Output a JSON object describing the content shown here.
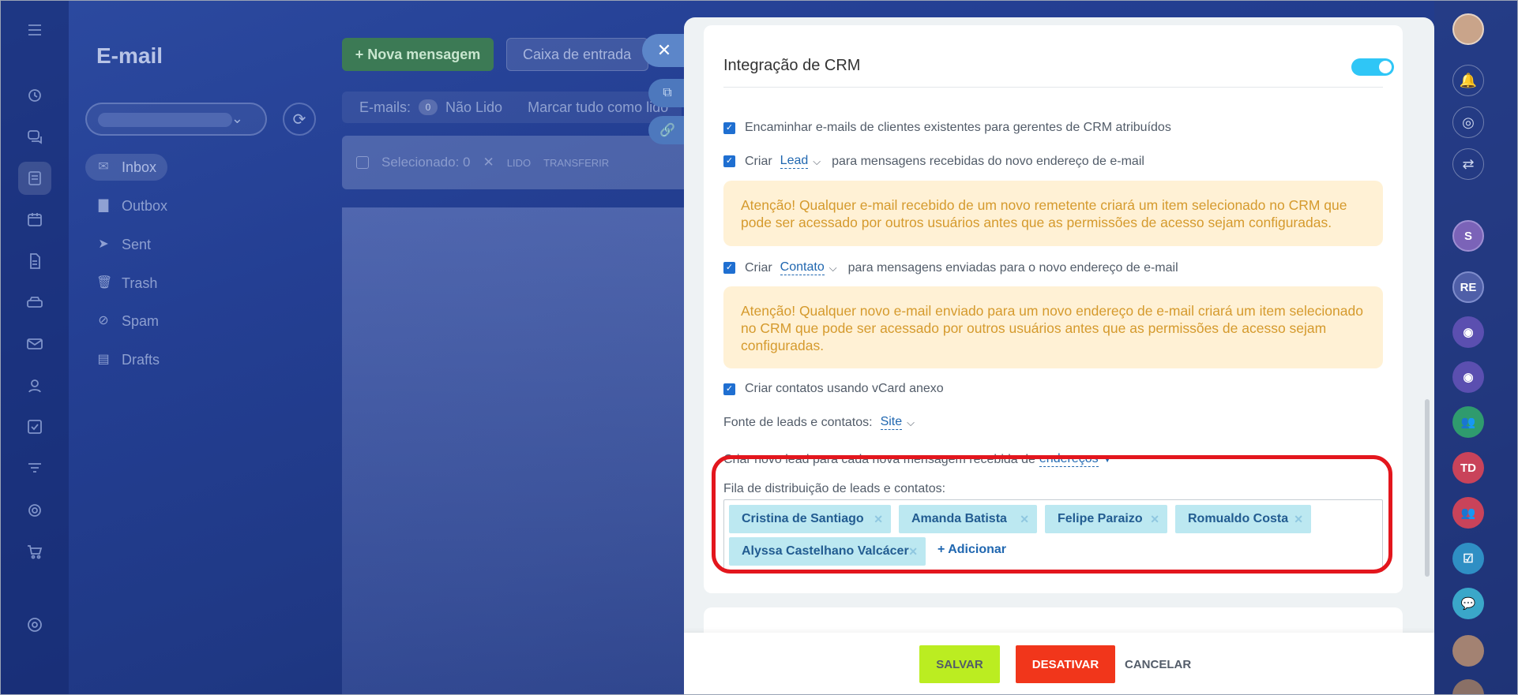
{
  "mail": {
    "title": "E-mail",
    "new_message": "+ Nova mensagem",
    "inbox_select": "Caixa de entrada",
    "emails_label": "E-mails:",
    "unread_count": "0",
    "unread_label": "Não Lido",
    "mark_all": "Marcar tudo como lido",
    "selected": "Selecionado: 0",
    "read_action": "LIDO",
    "transfer_action": "TRANSFERIR",
    "folders": [
      {
        "label": "Inbox",
        "icon": "inbox-icon"
      },
      {
        "label": "Outbox",
        "icon": "folder-icon"
      },
      {
        "label": "Sent",
        "icon": "sent-icon"
      },
      {
        "label": "Trash",
        "icon": "trash-icon"
      },
      {
        "label": "Spam",
        "icon": "spam-icon"
      },
      {
        "label": "Drafts",
        "icon": "drafts-icon"
      }
    ]
  },
  "panel": {
    "title": "Integração de CRM",
    "toggle_on": true,
    "forward_existing": "Encaminhar e-mails de clientes existentes para gerentes de CRM atribuídos",
    "create_label": "Criar",
    "lead_option": "Lead",
    "lead_suffix": "para mensagens recebidas do novo endereço de e-mail",
    "warning_1": "Atenção! Qualquer e-mail recebido de um novo remetente criará um item selecionado no CRM que pode ser acessado por outros usuários antes que as permissões de acesso sejam configuradas.",
    "contact_option": "Contato",
    "contact_suffix": "para mensagens enviadas para o novo endereço de e-mail",
    "warning_2": "Atenção! Qualquer novo e-mail enviado para um novo endereço de e-mail criará um item selecionado no CRM que pode ser acessado por outros usuários antes que as permissões de acesso sejam configuradas.",
    "vcard": "Criar contatos usando vCard anexo",
    "source_label": "Fonte de leads e contatos:",
    "source_value": "Site",
    "new_lead_label": "Criar novo lead para cada nova mensagem recebida de",
    "new_lead_value": "endereços",
    "queue_label": "Fila de distribuição de leads e contatos:",
    "queue": [
      "Cristina de Santiago",
      "Amanda Batista",
      "Felipe Paraizo",
      "Romualdo Costa",
      "Alyssa Castelhano Valcácer"
    ],
    "add_label": "+ Adicionar"
  },
  "footer": {
    "save": "SALVAR",
    "deactivate": "DESATIVAR",
    "cancel": "CANCELAR"
  },
  "right_rail": {
    "avatars": [
      "S",
      "RE",
      "TD"
    ]
  },
  "colors": {
    "accent": "#2fc6f6",
    "save_bg": "#bbed21",
    "deactivate_bg": "#f1361b",
    "warning_bg": "#fff1d5",
    "highlight": "#e3161d"
  }
}
